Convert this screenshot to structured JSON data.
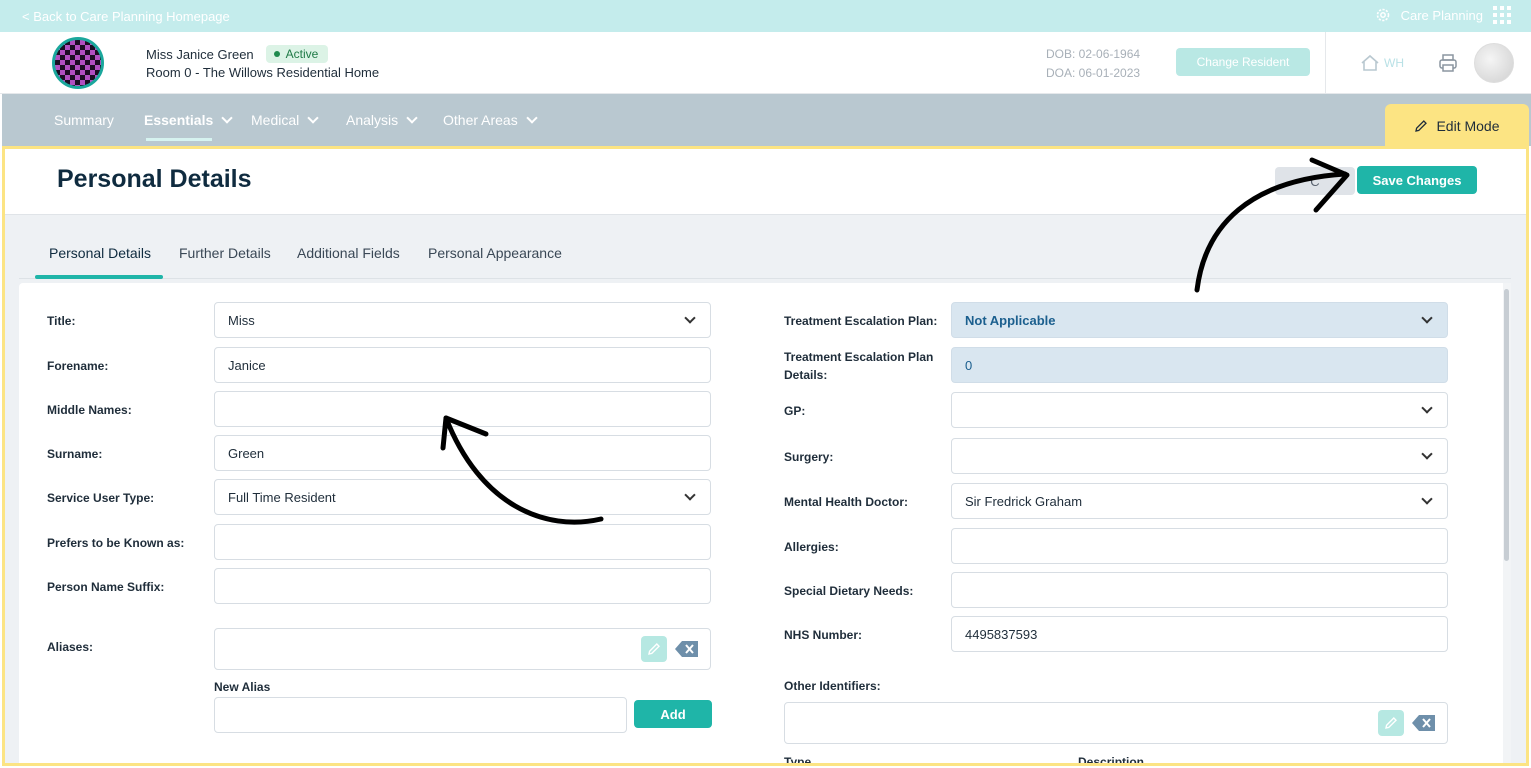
{
  "topbar": {
    "back_label": "< Back to Care Planning Homepage",
    "app_label": "Care Planning"
  },
  "resident": {
    "name": "Miss Janice Green",
    "status": "Active",
    "room": "Room 0 - The Willows Residential Home",
    "dob": "DOB: 02-06-1964",
    "doa": "DOA: 06-01-2023",
    "change_label": "Change Resident",
    "home_code": "WH"
  },
  "nav": {
    "items": [
      "Summary",
      "Essentials",
      "Medical",
      "Analysis",
      "Other Areas"
    ],
    "edit_mode": "Edit Mode"
  },
  "page": {
    "title": "Personal Details",
    "cancel_label": "C",
    "save_label": "Save Changes"
  },
  "tabs": [
    "Personal Details",
    "Further Details",
    "Additional Fields",
    "Personal Appearance"
  ],
  "left": {
    "title": {
      "label": "Title:",
      "value": "Miss"
    },
    "forename": {
      "label": "Forename:",
      "value": "Janice"
    },
    "middle": {
      "label": "Middle Names:",
      "value": ""
    },
    "surname": {
      "label": "Surname:",
      "value": "Green"
    },
    "service_type": {
      "label": "Service User Type:",
      "value": "Full Time Resident"
    },
    "known_as": {
      "label": "Prefers to be Known as:",
      "value": ""
    },
    "suffix": {
      "label": "Person Name Suffix:",
      "value": ""
    },
    "aliases": {
      "label": "Aliases:",
      "value": ""
    },
    "new_alias": {
      "label": "New Alias",
      "value": "",
      "add_label": "Add"
    }
  },
  "right": {
    "tep": {
      "label": "Treatment Escalation Plan:",
      "value": "Not Applicable"
    },
    "tep_details": {
      "label": "Treatment Escalation Plan Details:",
      "value": "0"
    },
    "gp": {
      "label": "GP:",
      "value": ""
    },
    "surgery": {
      "label": "Surgery:",
      "value": ""
    },
    "mh_doctor": {
      "label": "Mental Health Doctor:",
      "value": "Sir Fredrick Graham"
    },
    "allergies": {
      "label": "Allergies:",
      "value": ""
    },
    "diet": {
      "label": "Special Dietary Needs:",
      "value": ""
    },
    "nhs": {
      "label": "NHS Number:",
      "value": "4495837593"
    },
    "other_ids": {
      "label": "Other Identifiers:",
      "value": ""
    },
    "col_type": "Type",
    "col_desc": "Description"
  },
  "colors": {
    "accent": "#1fb5a8",
    "edit_mode": "#fce483",
    "nav": "#b9c8d0"
  }
}
